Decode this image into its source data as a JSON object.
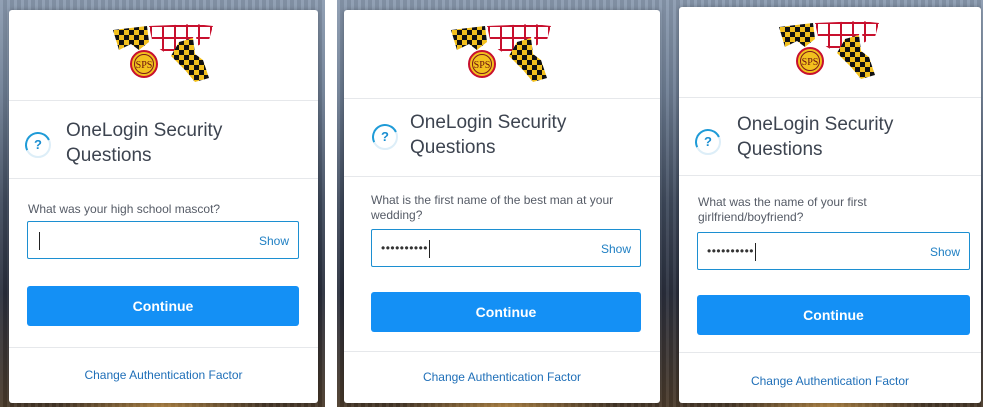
{
  "panels": [
    {
      "title": "OneLogin Security Questions",
      "title_line1": "OneLogin Security",
      "title_line2": "Questions",
      "question_line1": "What was your high school mascot?",
      "question_line2": "",
      "input_value": "",
      "show_label": "Show",
      "continue_label": "Continue",
      "change_factor_label": "Change Authentication Factor"
    },
    {
      "title": "OneLogin Security Questions",
      "title_line1": "OneLogin Security",
      "title_line2": "Questions",
      "question_line1": "What is the first name of the best man at your",
      "question_line2": "wedding?",
      "input_value": "••••••••••",
      "show_label": "Show",
      "continue_label": "Continue",
      "change_factor_label": "Change Authentication Factor"
    },
    {
      "title": "OneLogin Security Questions",
      "title_line1": "OneLogin Security",
      "title_line2": "Questions",
      "question_line1": "What was the name of your first",
      "question_line2": "girlfriend/boyfriend?",
      "input_value": "••••••••••",
      "show_label": "Show",
      "continue_label": "Continue",
      "change_factor_label": "Change Authentication Factor"
    }
  ],
  "logo": {
    "seal_text": "SPS",
    "icon": "maryland-state-flag-map-logo"
  },
  "question_icon": {
    "glyph": "?",
    "icon": "question-spinner-icon"
  },
  "colors": {
    "accent": "#1490f5",
    "link": "#1f6fb8",
    "input_border": "#1c8fd1",
    "title": "#3d4450"
  }
}
